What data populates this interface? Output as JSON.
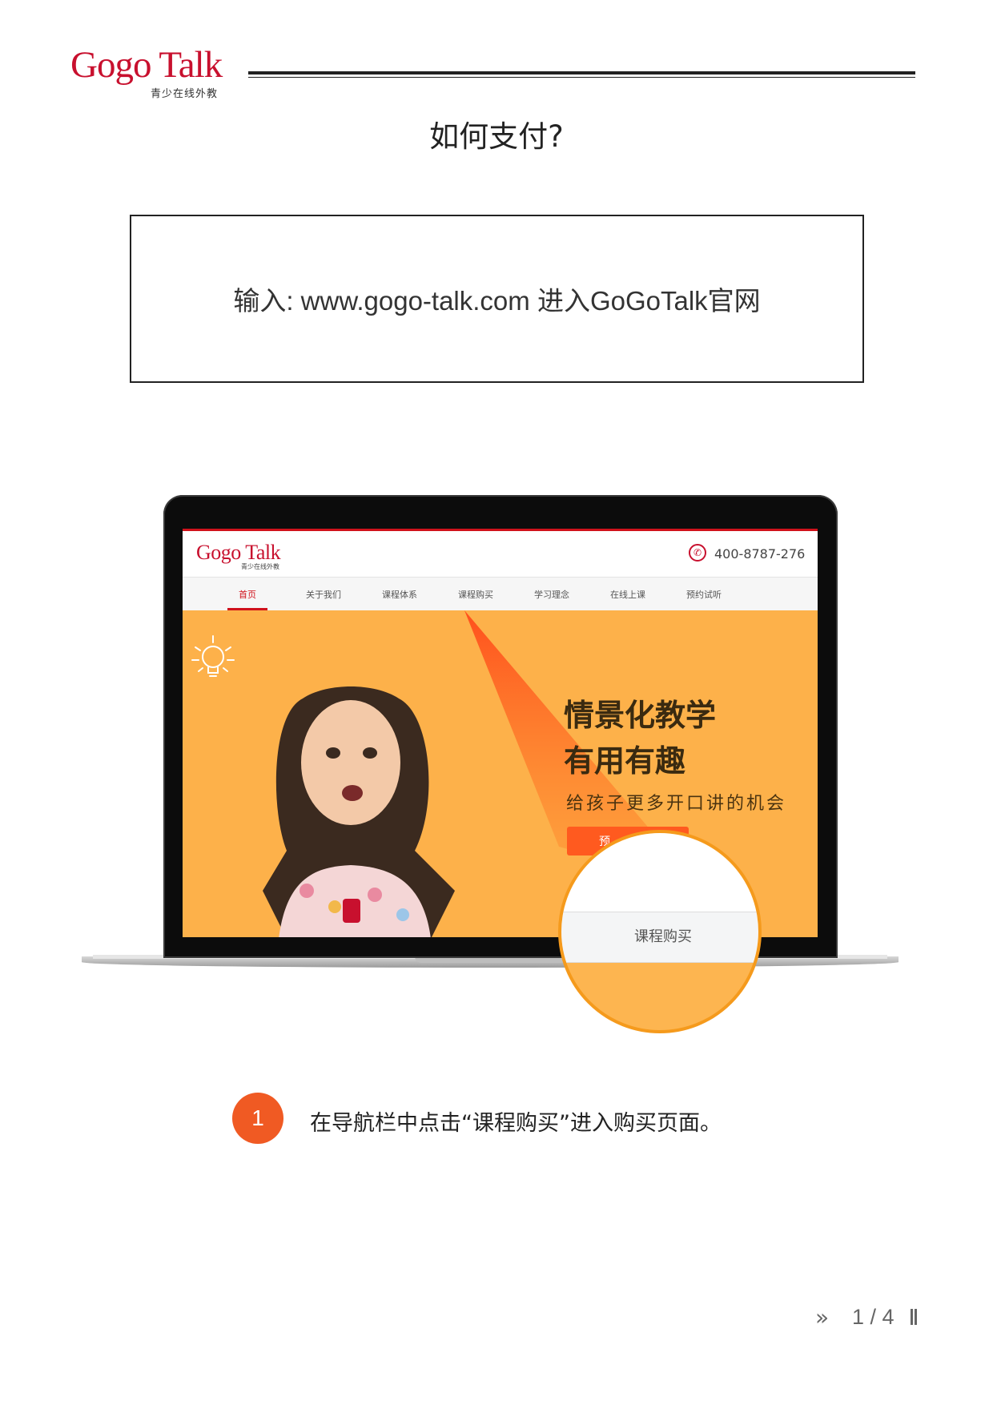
{
  "header": {
    "logo_text": "Gogo Talk",
    "logo_tagline": "青少在线外教"
  },
  "page_title": "如何支付?",
  "instruction_box": {
    "text": "输入: www.gogo-talk.com 进入GoGoTalk官网"
  },
  "screenshot": {
    "site_logo": "Gogo Talk",
    "site_logo_tagline": "青少在线外教",
    "phone": "400-8787-276",
    "nav": [
      {
        "label": "首页",
        "active": true
      },
      {
        "label": "关于我们",
        "active": false
      },
      {
        "label": "课程体系",
        "active": false
      },
      {
        "label": "课程购买",
        "active": false
      },
      {
        "label": "学习理念",
        "active": false
      },
      {
        "label": "在线上课",
        "active": false
      },
      {
        "label": "预约试听",
        "active": false
      }
    ],
    "hero_title_line1": "情景化教学",
    "hero_title_line2": "有用有趣",
    "hero_subtitle": "给孩子更多开口讲的机会",
    "hero_button": "预",
    "magnifier_label": "课程购买"
  },
  "step": {
    "number": "1",
    "text": "在导航栏中点击“课程购买”进入购买页面。"
  },
  "footer": {
    "arrows": "»",
    "page_indicator": "1 / 4"
  },
  "colors": {
    "brand_red": "#c8102e",
    "accent_orange": "#f05a23",
    "hero_yellow": "#fdb14a",
    "magnifier_border": "#f59a1c"
  }
}
